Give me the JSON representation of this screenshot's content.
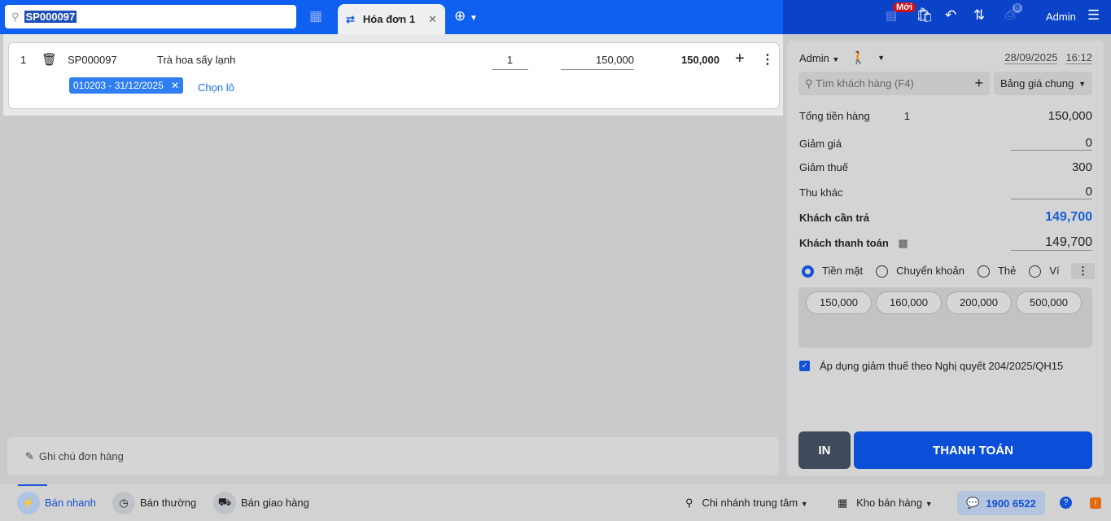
{
  "search": {
    "value": "SP000097"
  },
  "tab": {
    "label": "Hóa đơn 1"
  },
  "header": {
    "new_badge": "Mới",
    "printer_badge": "B",
    "user": "Admin"
  },
  "cart": {
    "items": [
      {
        "index": "1",
        "code": "SP000097",
        "name": "Trà hoa sấy lạnh",
        "quantity": "1",
        "price": "150,000",
        "total": "150,000",
        "lot": "010203 - 31/12/2025",
        "choose_lot": "Chọn lô"
      }
    ],
    "note_placeholder": "Ghi chú đơn hàng"
  },
  "panel": {
    "seller": "Admin",
    "date": "28/09/2025",
    "time": "16:12",
    "customer_placeholder": "Tìm khách hàng (F4)",
    "price_list": "Bảng giá chung",
    "total_label": "Tổng tiền hàng",
    "total_qty": "1",
    "total_value": "150,000",
    "discount_label": "Giảm giá",
    "discount_value": "0",
    "tax_label": "Giảm thuế",
    "tax_value": "300",
    "other_label": "Thu khác",
    "other_value": "0",
    "due_label": "Khách cần trả",
    "due_value": "149,700",
    "paid_label": "Khách thanh toán",
    "paid_value": "149,700",
    "methods": [
      "Tiền mặt",
      "Chuyển khoản",
      "Thẻ",
      "Ví"
    ],
    "amounts": [
      "150,000",
      "160,000",
      "200,000",
      "500,000"
    ],
    "tax_checkbox": "Áp dụng giảm thuế theo Nghị quyết 204/2025/QH15",
    "print": "IN",
    "pay": "THANH TOÁN"
  },
  "footer": {
    "modes": [
      "Bán nhanh",
      "Bán thường",
      "Bán giao hàng"
    ],
    "branch": "Chi nhánh trung tâm",
    "warehouse": "Kho bán hàng",
    "hotline": "1900 6522"
  }
}
